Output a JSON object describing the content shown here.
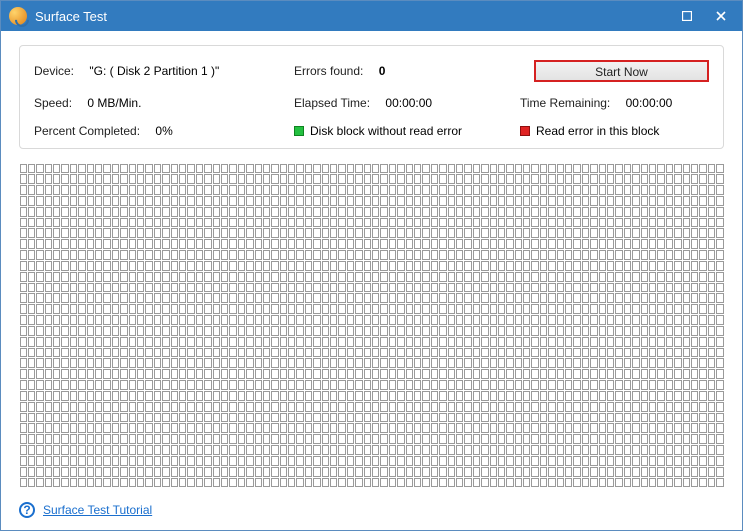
{
  "window_title": "Surface Test",
  "info": {
    "device_label": "Device:",
    "device_value": "\"G: ( Disk 2 Partition 1 )\"",
    "errors_label": "Errors found:",
    "errors_value": "0",
    "speed_label": "Speed:",
    "speed_value": "0 MB/Min.",
    "elapsed_label": "Elapsed Time:",
    "elapsed_value": "00:00:00",
    "remaining_label": "Time Remaining:",
    "remaining_value": "00:00:00",
    "percent_label": "Percent Completed:",
    "percent_value": "0%",
    "legend_ok": "Disk block without read error",
    "legend_err": "Read error in this block"
  },
  "start_button": "Start Now",
  "tutorial_link": "Surface Test Tutorial",
  "block_grid": {
    "cols": 84,
    "rows": 30
  }
}
